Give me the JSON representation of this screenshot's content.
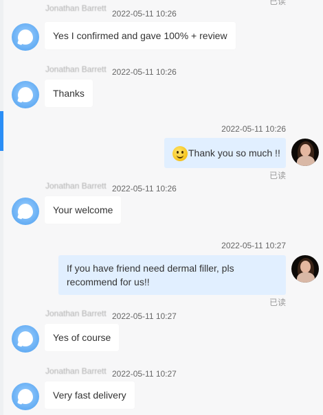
{
  "read_label": "已读",
  "messages": [
    {
      "direction": "in",
      "sender": "Jonathan Barrett",
      "time": "2022-05-11 10:26",
      "text": "Yes I confirmed and gave 100% + review"
    },
    {
      "direction": "in",
      "sender": "Jonathan Barrett",
      "time": "2022-05-11 10:26",
      "text": "Thanks"
    },
    {
      "direction": "out",
      "time": "2022-05-11 10:26",
      "emoji": "smiley-emoji",
      "text": "Thank you so much !!",
      "status": "已读"
    },
    {
      "direction": "in",
      "sender": "Jonathan Barrett",
      "time": "2022-05-11 10:26",
      "text": "Your welcome"
    },
    {
      "direction": "out",
      "time": "2022-05-11 10:27",
      "text_lines": [
        "If you have friend need dermal filler, pls",
        "recommend for us!!"
      ],
      "status": "已读"
    },
    {
      "direction": "in",
      "sender": "Jonathan Barrett",
      "time": "2022-05-11 10:27",
      "text": "Yes of course"
    },
    {
      "direction": "in",
      "sender": "Jonathan Barrett",
      "time": "2022-05-11 10:27",
      "text": "Very fast delivery"
    }
  ],
  "colors": {
    "background": "#f7f7f8",
    "incoming_bubble": "#ffffff",
    "outgoing_bubble": "#e1efff",
    "accent": "#2b8ef6"
  }
}
